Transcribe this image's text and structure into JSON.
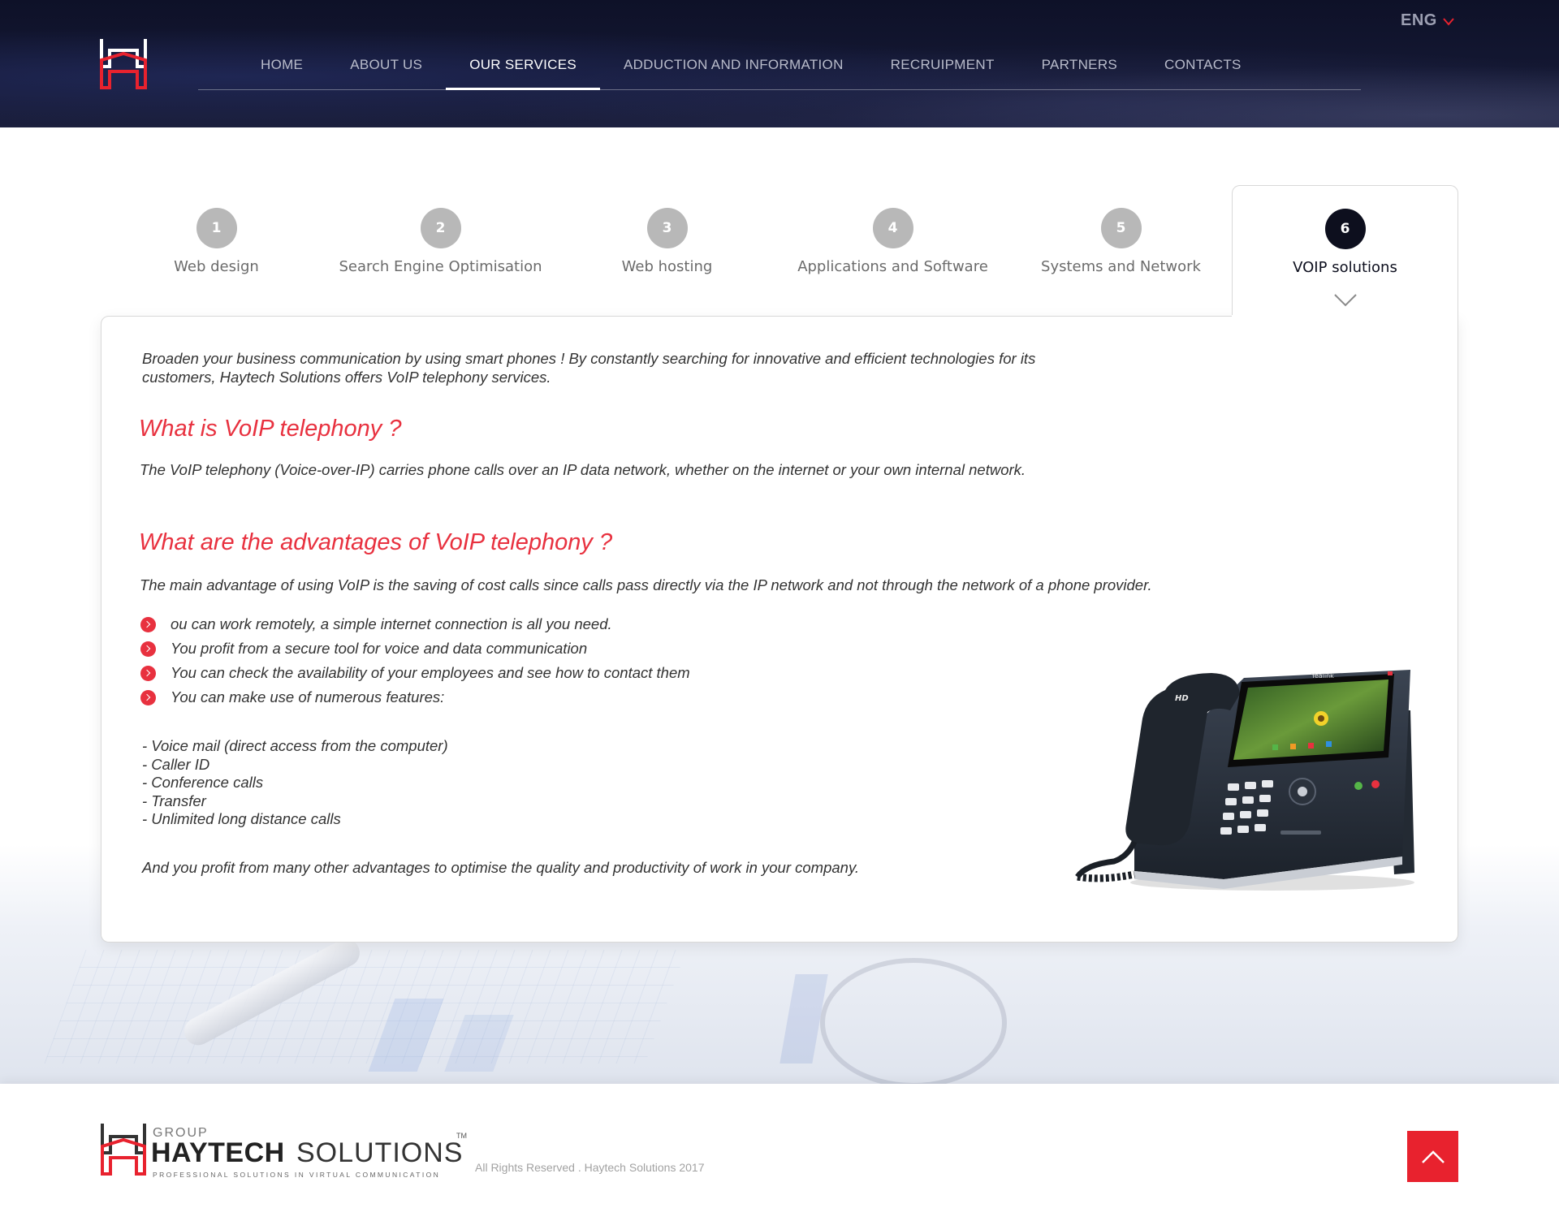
{
  "header": {
    "nav": [
      {
        "label": "HOME",
        "active": false
      },
      {
        "label": "ABOUT US",
        "active": false
      },
      {
        "label": "OUR SERVICES",
        "active": true
      },
      {
        "label": "ADDUCTION AND INFORMATION",
        "active": false
      },
      {
        "label": "RECRUIPMENT",
        "active": false
      },
      {
        "label": "PARTNERS",
        "active": false
      },
      {
        "label": "CONTACTS",
        "active": false
      }
    ],
    "language": "ENG",
    "language_icon": "chevron-down-icon"
  },
  "tabs": [
    {
      "number": "1",
      "label": "Web design"
    },
    {
      "number": "2",
      "label": "Search Engine Optimisation"
    },
    {
      "number": "3",
      "label": "Web hosting"
    },
    {
      "number": "4",
      "label": "Applications and Software"
    },
    {
      "number": "5",
      "label": "Systems and Network"
    },
    {
      "number": "6",
      "label": "VOIP solutions"
    }
  ],
  "active_tab": "6",
  "content": {
    "intro": "Broaden your business communication by using smart phones ! By constantly searching for innovative and efficient technologies for its customers, Haytech Solutions offers VoIP telephony services.",
    "heading1": "What is VoIP telephony ?",
    "paragraph1": "The VoIP telephony (Voice-over-IP) carries phone calls over an IP data network, whether on the internet or your own internal network.",
    "heading2": "What are the advantages of VoIP telephony ?",
    "paragraph2": "The main advantage of using VoIP is the saving of cost calls since calls pass directly via the IP network and not through the network of a phone provider.",
    "bullets": [
      "ou can work remotely, a simple internet connection is all you need.",
      "You profit from a secure tool for voice and data communication",
      "You can check the availability of your employees and see how to contact them",
      "You can make use of numerous features:"
    ],
    "features": [
      "- Voice mail (direct access from the computer)",
      "- Caller ID",
      "- Conference calls",
      "- Transfer",
      "- Unlimited long distance calls"
    ],
    "closing": "And you profit from many other advantages to optimise the quality and productivity of work in your company.",
    "phone_brand": "Yealink",
    "phone_badge": "HD"
  },
  "footer": {
    "brand_group": "GROUP",
    "brand_name": "HAYTECH",
    "brand_suffix": "SOLUTIONS",
    "brand_tm": "TM",
    "tagline": "PROFESSIONAL SOLUTIONS IN VIRTUAL COMMUNICATION",
    "copyright": "All Rights Reserved . Haytech Solutions 2017",
    "back_to_top_icon": "arrow-up-icon"
  },
  "colors": {
    "accent_red": "#e8313f",
    "header_dark": "#0e1128",
    "active_tab_circle": "#0d0f1e",
    "inactive_tab_circle": "#b8b8b8"
  }
}
